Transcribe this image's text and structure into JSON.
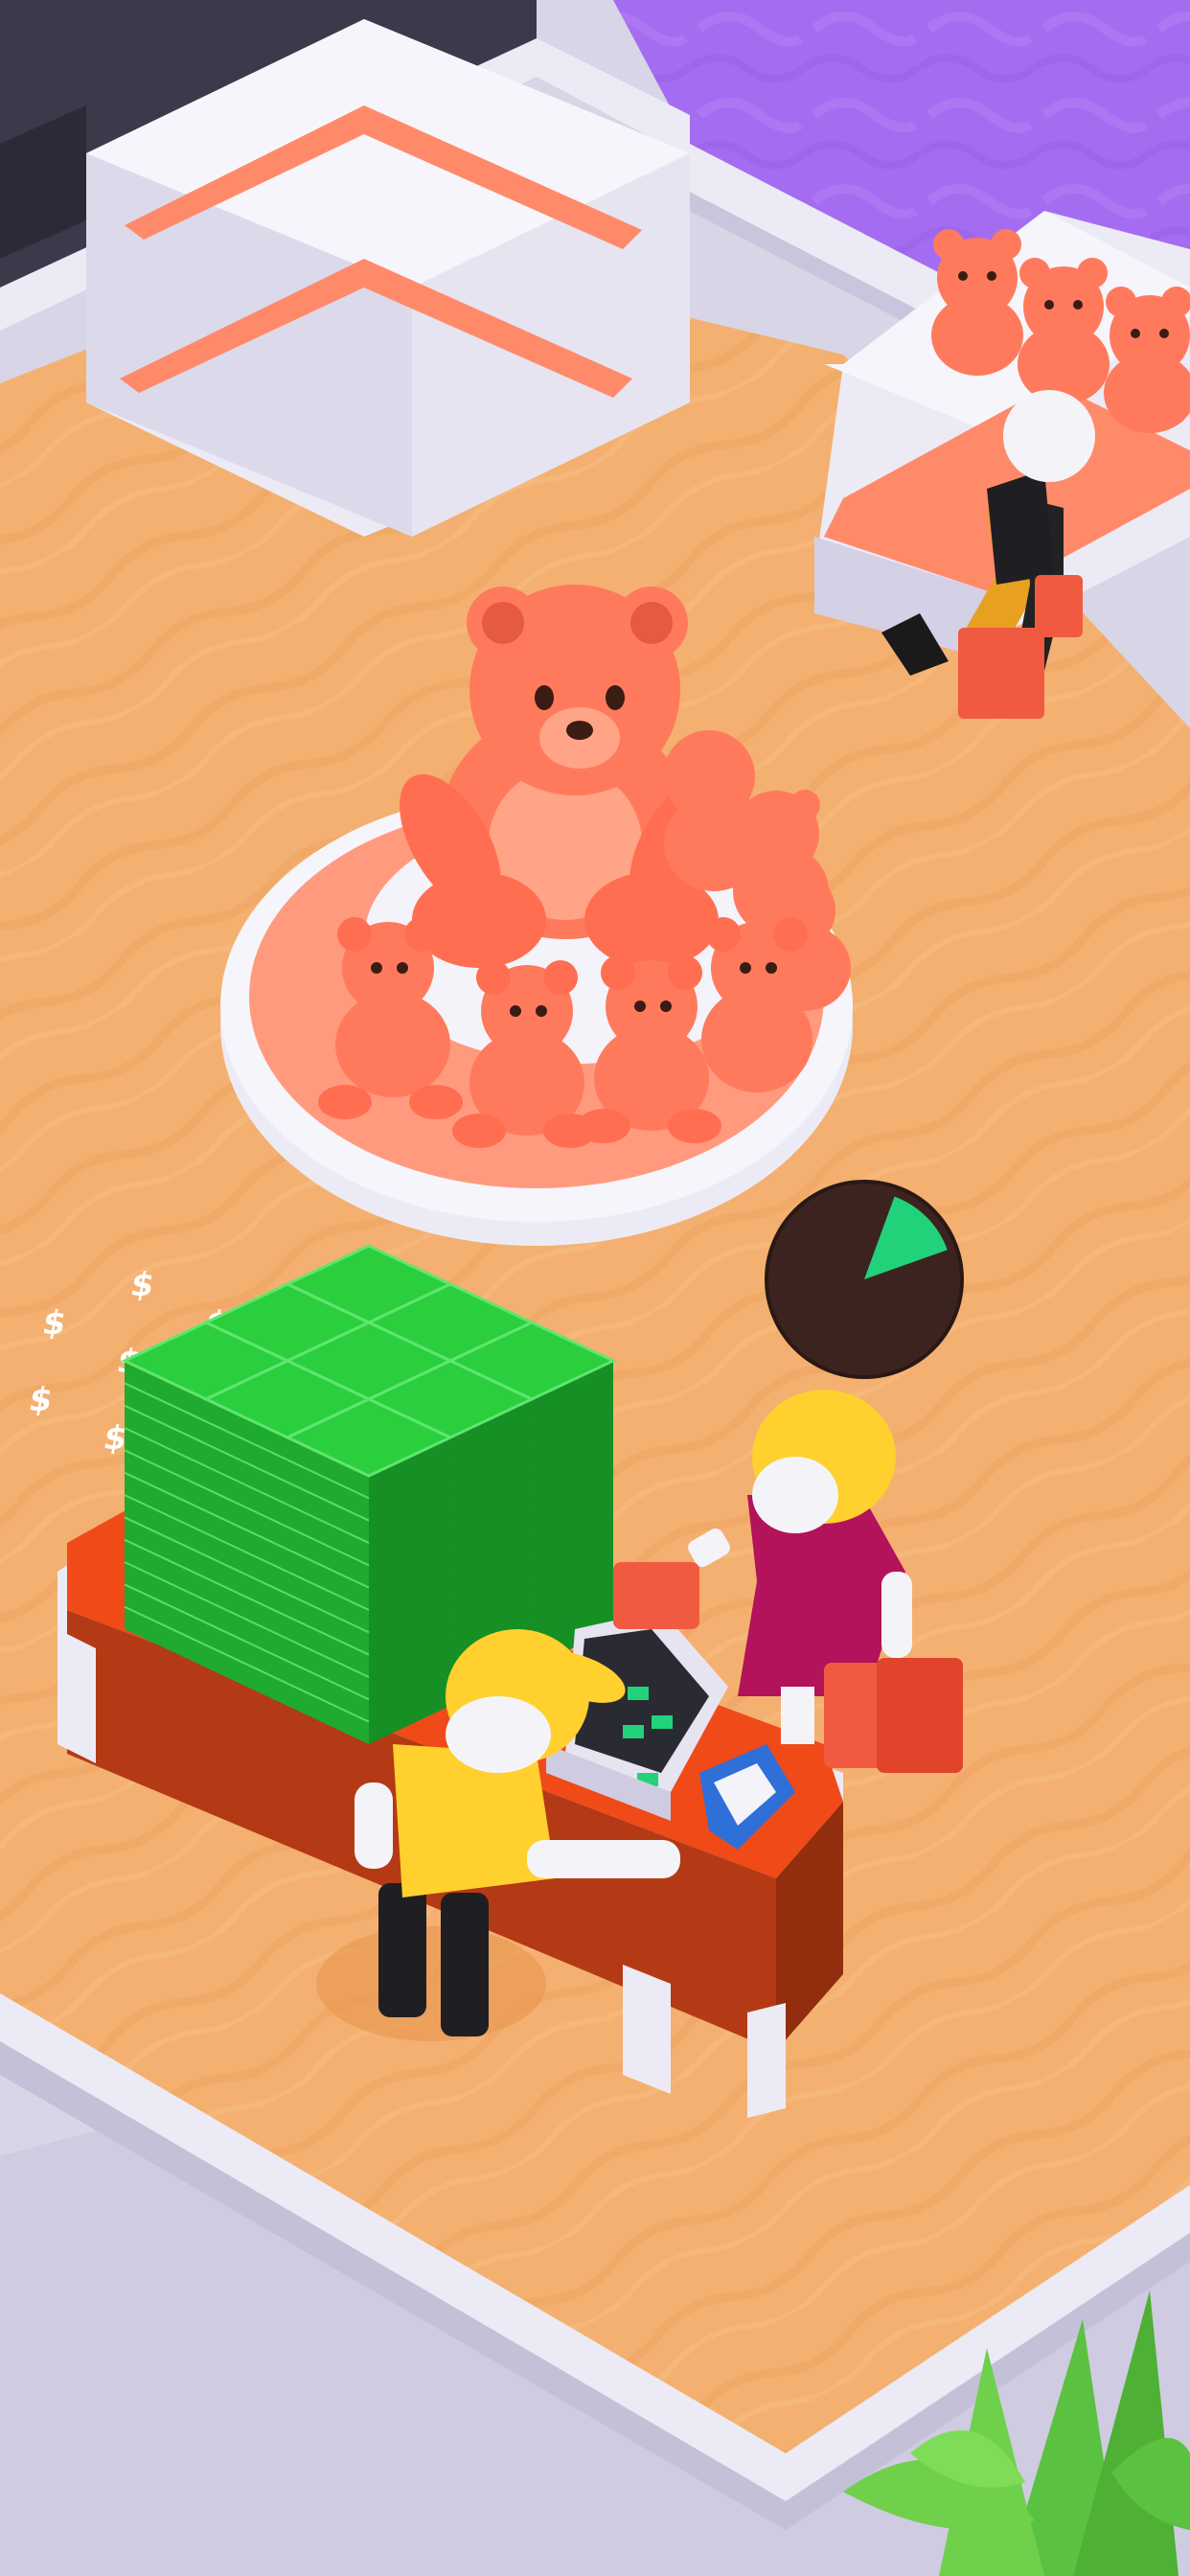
{
  "scene": {
    "type": "isometric toy store idle game",
    "colors": {
      "floor": "#f4b070",
      "floor_wave": "#eea35e",
      "wall_white": "#ecebf5",
      "wall_shade": "#c9c5dd",
      "purple_floor": "#a46cf0",
      "bear": "#ff7a5c",
      "bear_dark": "#e65a40",
      "cash_green": "#2bcf3e",
      "counter_red": "#f04a18",
      "progress_green": "#22d27a",
      "progress_bg": "#3b2420"
    }
  },
  "cash_stack": {
    "symbol": "$",
    "rows": 3,
    "cols": 3
  },
  "checkout_progress": {
    "fraction": 0.14
  },
  "icons": {
    "cash": "dollar-bill-stack",
    "timer": "circular-progress-timer"
  }
}
